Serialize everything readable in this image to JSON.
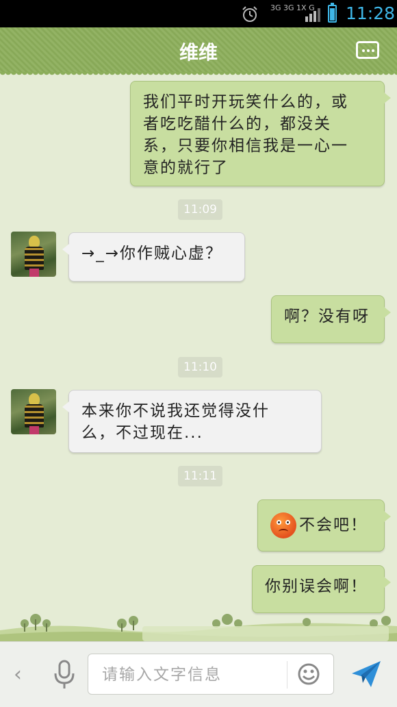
{
  "status_bar": {
    "network_label": "3G 3G 1X G",
    "time": "11:28",
    "battery_level": 0.8
  },
  "header": {
    "title": "维维",
    "menu_icon": "more-dots-icon"
  },
  "messages": [
    {
      "type": "out",
      "text_lines": [
        "我们平时开玩笑什么的，或",
        "者吃吃醋什么的，都没关",
        "系，只要你相信我是一心一",
        "意的就行了"
      ]
    },
    {
      "type": "time",
      "text": "11:09"
    },
    {
      "type": "in",
      "text_lines": [
        "→_→你作贼心虚？"
      ]
    },
    {
      "type": "out",
      "text_lines": [
        "啊？没有呀"
      ]
    },
    {
      "type": "time",
      "text": "11:10"
    },
    {
      "type": "in",
      "text_lines": [
        "本来你不说我还觉得没什",
        "么，不过现在..."
      ]
    },
    {
      "type": "time",
      "text": "11:11"
    },
    {
      "type": "out",
      "emoji": "worried-face-emoji",
      "text_lines": [
        "不会吧！"
      ]
    },
    {
      "type": "out",
      "text_lines": [
        "你别误会啊！"
      ]
    }
  ],
  "input_bar": {
    "placeholder": "请输入文字信息",
    "value": "",
    "icons": [
      "back-chevron-icon",
      "microphone-icon",
      "smiley-icon",
      "send-plane-icon"
    ]
  },
  "colors": {
    "header": "#8cae5b",
    "outgoing_bubble": "#c8dea0",
    "incoming_bubble": "#f2f2f2",
    "background": "#e5ecd5",
    "send_accent": "#2e8fd8"
  }
}
